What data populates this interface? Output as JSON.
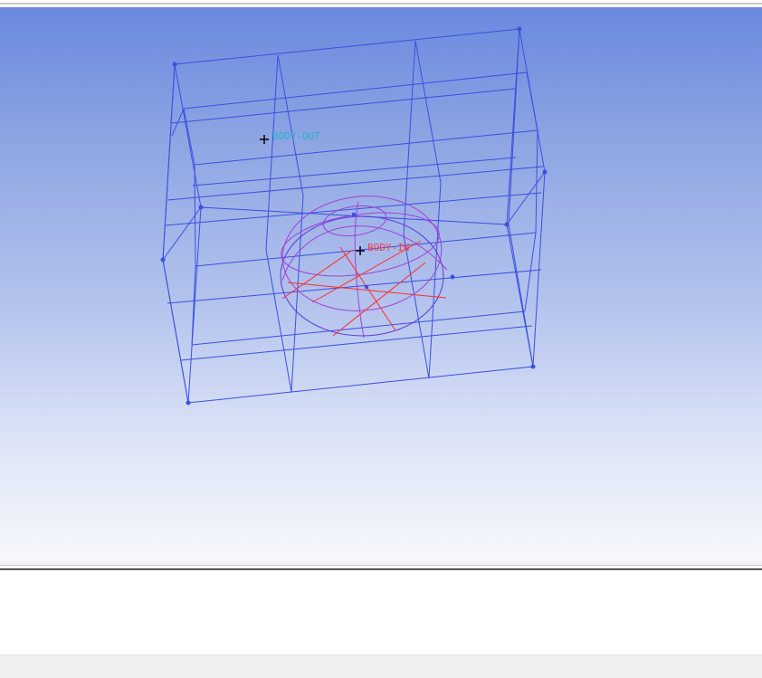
{
  "viewport": {
    "labels": {
      "body_out": "BODY-OUT",
      "body_in": "BODY-IN"
    },
    "colors": {
      "outer_box": "#3b4fe0",
      "inner_sphere": "#a23fd6",
      "inner_cross": "#ff2b2b",
      "body_out_label": "#23b3c8",
      "body_in_label": "#ff3b3b",
      "marker": "#000000"
    }
  },
  "message_panel": {
    "text": ""
  },
  "status_bar": {
    "text": ""
  }
}
